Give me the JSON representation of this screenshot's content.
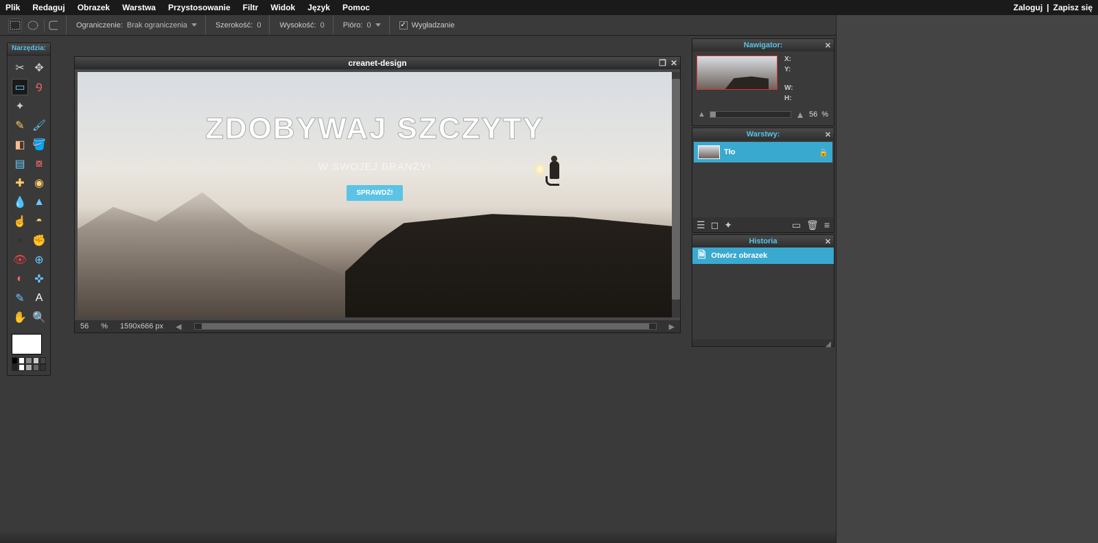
{
  "menubar": {
    "items": [
      "Plik",
      "Redaguj",
      "Obrazek",
      "Warstwa",
      "Przystosowanie",
      "Filtr",
      "Widok",
      "Język",
      "Pomoc"
    ],
    "login": "Zaloguj",
    "sep": "|",
    "signup": "Zapisz się"
  },
  "optionsbar": {
    "constraint_label": "Ograniczenie:",
    "constraint_value": "Brak ograniczenia",
    "width_label": "Szerokość:",
    "width_value": "0",
    "height_label": "Wysokość:",
    "height_value": "0",
    "feather_label": "Pióro:",
    "feather_value": "0",
    "antialias_label": "Wygładzanie",
    "antialias_checked": true
  },
  "tools_panel": {
    "title": "Narzędzia:",
    "tools": [
      {
        "name": "crop",
        "glyph": "✂"
      },
      {
        "name": "move",
        "glyph": "✥"
      },
      {
        "name": "marquee",
        "glyph": "▭",
        "selected": true
      },
      {
        "name": "lasso",
        "glyph": "݀Ꝯ"
      },
      {
        "name": "wand",
        "glyph": "✦"
      },
      {
        "name": "empty1",
        "glyph": ""
      },
      {
        "name": "pencil",
        "glyph": "✎"
      },
      {
        "name": "brush",
        "glyph": "🖌"
      },
      {
        "name": "eraser",
        "glyph": "◧"
      },
      {
        "name": "bucket",
        "glyph": "🪣"
      },
      {
        "name": "gradient",
        "glyph": "▤"
      },
      {
        "name": "stamp",
        "glyph": "⧇"
      },
      {
        "name": "repair",
        "glyph": "✚"
      },
      {
        "name": "heal",
        "glyph": "◉"
      },
      {
        "name": "blur",
        "glyph": "💧"
      },
      {
        "name": "sharpen",
        "glyph": "▲"
      },
      {
        "name": "smudge",
        "glyph": "☝"
      },
      {
        "name": "sponge",
        "glyph": "◓"
      },
      {
        "name": "dodge",
        "glyph": "●"
      },
      {
        "name": "burn",
        "glyph": "✊"
      },
      {
        "name": "redeye",
        "glyph": "👁"
      },
      {
        "name": "spot",
        "glyph": "⊕"
      },
      {
        "name": "bulge",
        "glyph": "◐"
      },
      {
        "name": "pinch",
        "glyph": "✜"
      },
      {
        "name": "picker",
        "glyph": "✎"
      },
      {
        "name": "text",
        "glyph": "A"
      },
      {
        "name": "hand",
        "glyph": "✋"
      },
      {
        "name": "zoom",
        "glyph": "🔍"
      }
    ],
    "swatches": [
      [
        "#000",
        "#fff",
        "#888",
        "#ccc",
        "#444"
      ],
      [
        "#222",
        "#fff",
        "#aaa",
        "#666",
        "#333"
      ]
    ]
  },
  "canvas": {
    "title": "creanet-design",
    "overlay_main": "ZDOBYWAJ SZCZYTY",
    "overlay_sub": "W SWOJEJ BRANŻY!",
    "overlay_btn": "SPRAWDŹ!",
    "zoom_pct": "56",
    "pct_sym": "%",
    "dims": "1590x666 px"
  },
  "navigator": {
    "title": "Nawigator:",
    "x_label": "X:",
    "y_label": "Y:",
    "w_label": "W:",
    "h_label": "H:",
    "zoom": "56",
    "pct": "%"
  },
  "layers": {
    "title": "Warstwy:",
    "items": [
      {
        "name": "Tło",
        "locked": true
      }
    ]
  },
  "history": {
    "title": "Historia",
    "items": [
      {
        "label": "Otwórz obrazek"
      }
    ]
  }
}
